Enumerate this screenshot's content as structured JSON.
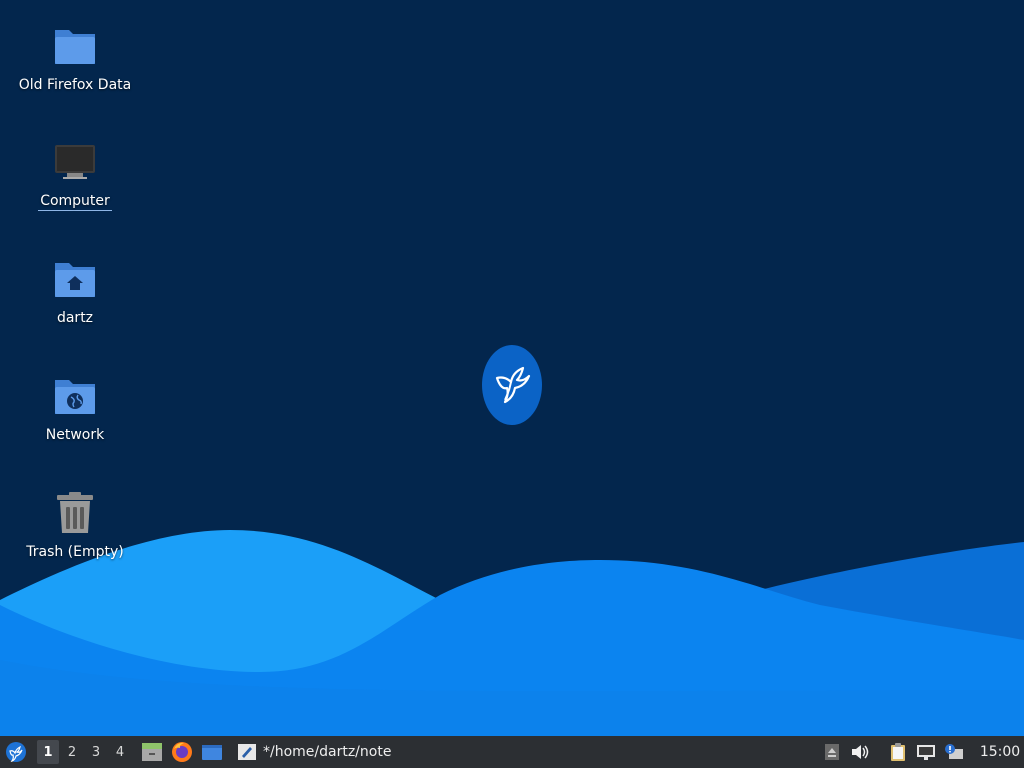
{
  "desktop": {
    "icons": [
      {
        "label": "Old Firefox Data",
        "icon": "folder-icon"
      },
      {
        "label": "Computer",
        "icon": "computer-icon"
      },
      {
        "label": "dartz",
        "icon": "home-folder-icon"
      },
      {
        "label": "Network",
        "icon": "network-folder-icon"
      },
      {
        "label": "Trash (Empty)",
        "icon": "trash-icon"
      }
    ],
    "colors": {
      "background": "#03264d",
      "wave_light": "#1b9ff8",
      "wave_mid": "#0b84f0",
      "wave_dark": "#0a6fd6",
      "logo": "#0b63c6"
    }
  },
  "taskbar": {
    "workspaces": [
      "1",
      "2",
      "3",
      "4"
    ],
    "active_workspace": "1",
    "task_title": "*/home/dartz/note",
    "clock": "15:00"
  }
}
